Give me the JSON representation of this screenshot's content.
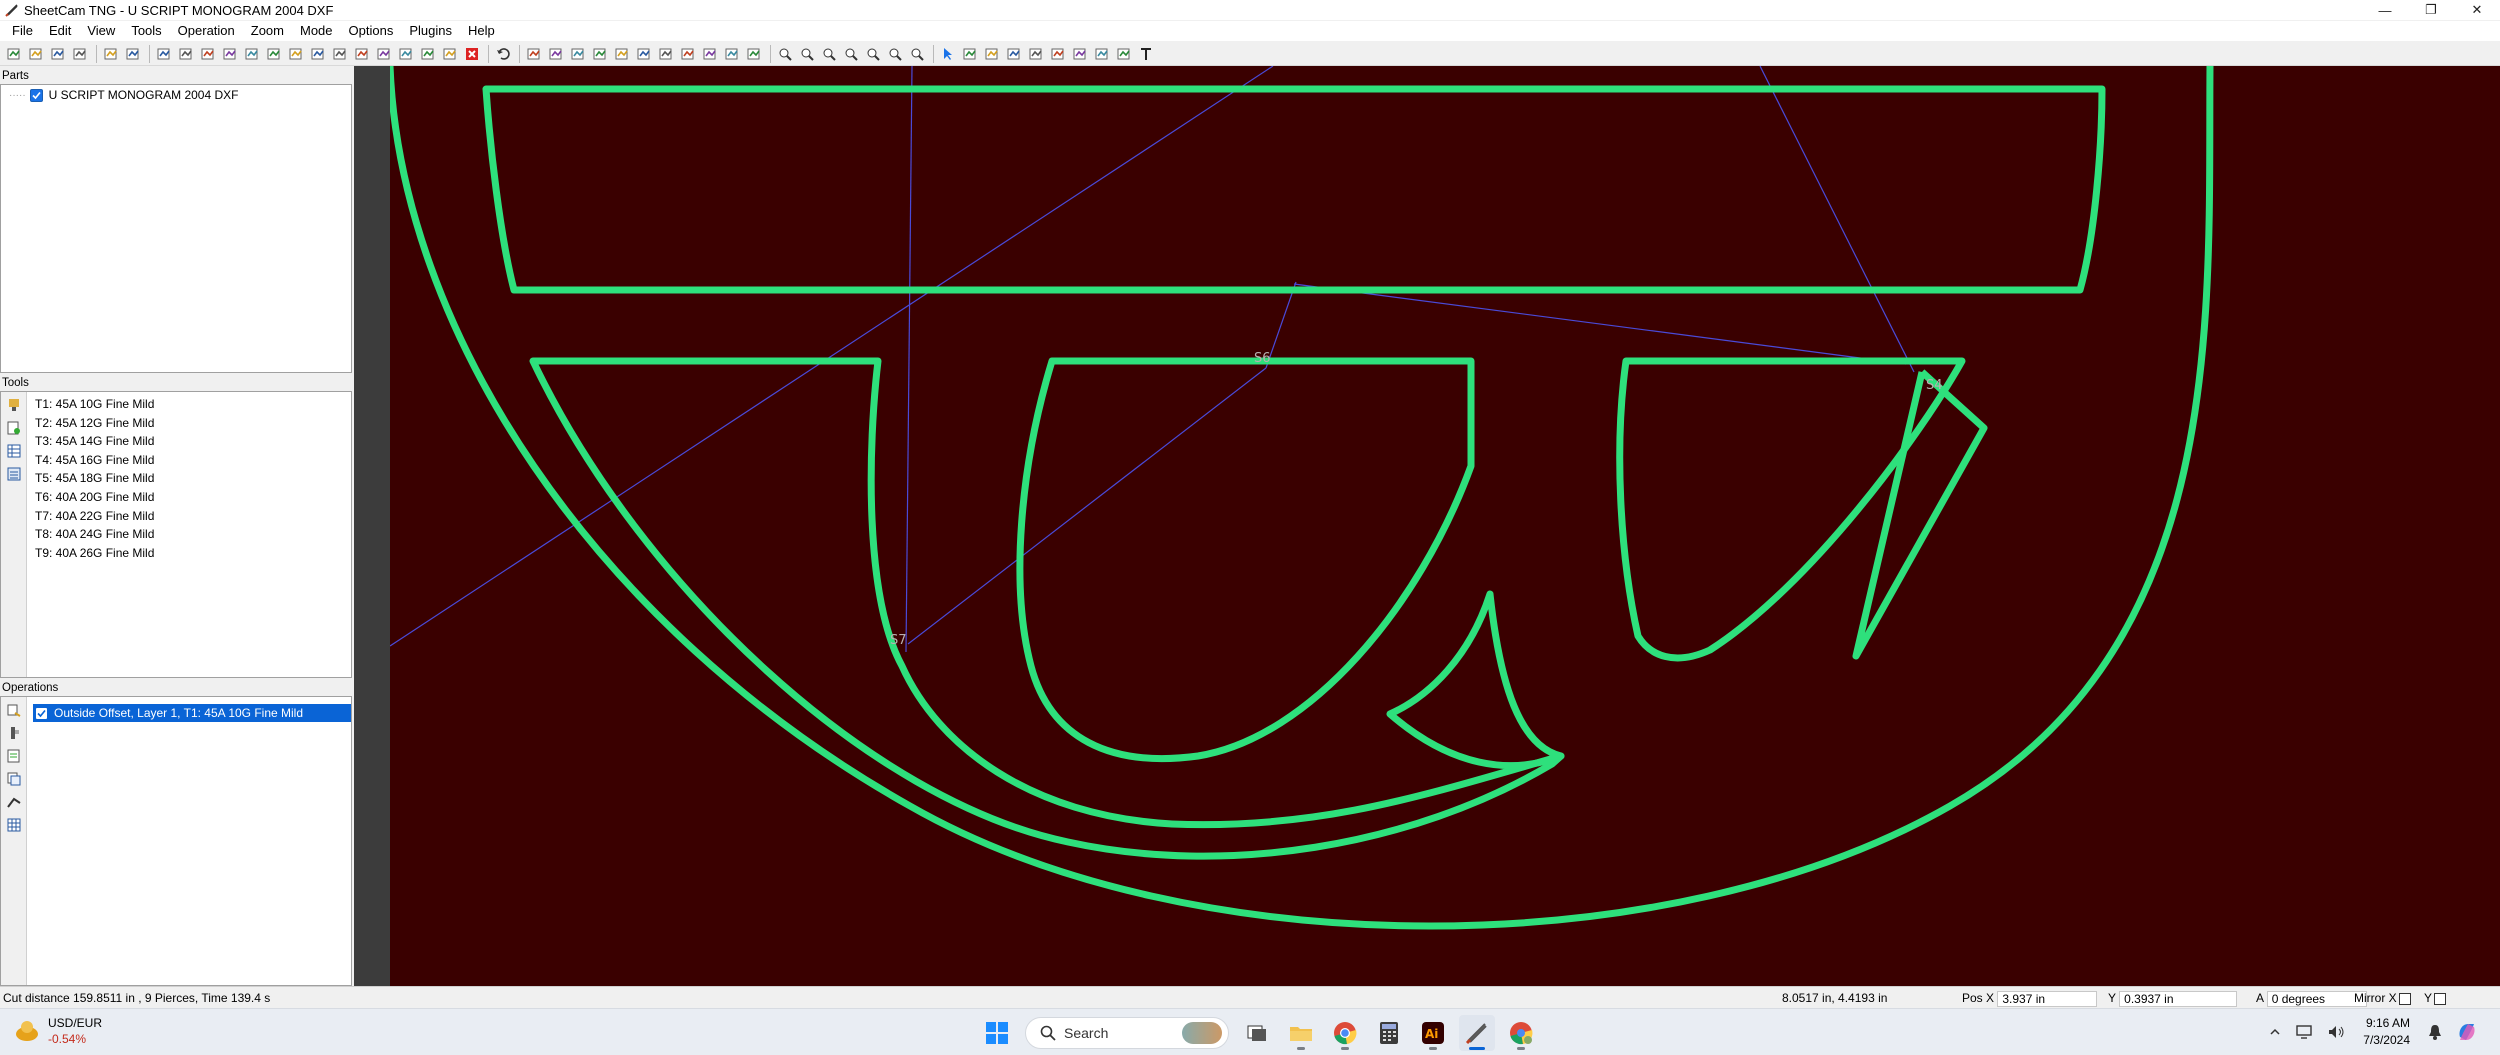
{
  "window": {
    "title": "SheetCam TNG - U SCRIPT MONOGRAM 2004 DXF",
    "controls": [
      "minimize-icon",
      "maximize-icon",
      "close-icon"
    ]
  },
  "menu": {
    "items": [
      "File",
      "Edit",
      "View",
      "Tools",
      "Operation",
      "Zoom",
      "Mode",
      "Options",
      "Plugins",
      "Help"
    ]
  },
  "toolbar": {
    "groups": [
      [
        "new-icon",
        "open-icon",
        "print-setup-icon",
        "print-icon"
      ],
      [
        "calculator-icon",
        "post-processor-icon"
      ],
      [
        "op-outline-icon",
        "op-pocket-icon",
        "op-drill-icon",
        "op-profile-icon",
        "op-jet-icon",
        "op-engrave-icon",
        "op-nest-icon",
        "op-route-icon",
        "op-tap-icon",
        "op-mark-icon",
        "op-bevel-icon",
        "op-region-icon",
        "op-toolchange-icon",
        "op-layer-icon",
        "delete-icon"
      ],
      [
        "undo-icon"
      ],
      [
        "view-3d-icon",
        "layers-icon",
        "table-icon",
        "stack-icon",
        "path-icon",
        "shape-icon",
        "snap-icon",
        "measure-icon",
        "nest-icon",
        "script-icon",
        "sheet-icon"
      ],
      [
        "zoom-in-icon",
        "zoom-out-icon",
        "zoom-fit-icon",
        "zoom-part-icon",
        "zoom-window-icon",
        "zoom-prev-icon",
        "zoom-next-icon"
      ],
      [
        "select-icon",
        "select-tool-icon",
        "node-edit-icon",
        "start-point-icon",
        "drill-point-icon",
        "move-icon",
        "rotate-icon",
        "scale-icon",
        "lead-icon",
        "text-icon"
      ]
    ]
  },
  "parts_panel": {
    "title": "Parts",
    "items": [
      {
        "label": "U SCRIPT MONOGRAM 2004 DXF",
        "checked": true
      }
    ]
  },
  "tools_panel": {
    "title": "Tools",
    "items": [
      "T1: 45A 10G Fine Mild",
      "T2: 45A 12G Fine Mild",
      "T3: 45A 14G Fine Mild",
      "T4: 45A 16G Fine Mild",
      "T5: 45A 18G Fine Mild",
      "T6: 40A 20G Fine Mild",
      "T7: 40A 22G Fine Mild",
      "T8: 40A 24G Fine Mild",
      "T9: 40A 26G Fine Mild"
    ],
    "side_icons": [
      "plasma-tool-icon",
      "new-tool-icon",
      "tool-table-icon",
      "tool-list-icon"
    ]
  },
  "operations_panel": {
    "title": "Operations",
    "items": [
      {
        "label": "Outside Offset, Layer 1, T1: 45A 10G Fine Mild",
        "checked": true,
        "selected": true
      }
    ],
    "side_icons": [
      "op-list-icon",
      "op-settings-icon",
      "op-edit-icon",
      "op-copy-icon",
      "op-path-icon",
      "op-table-icon"
    ]
  },
  "canvas": {
    "background": "#3a0000",
    "path_color": "#2ee07c",
    "rapid_color": "#4a4ad8",
    "labels": {
      "s4": "S4",
      "s6": "S6",
      "s7": "S7"
    }
  },
  "status": {
    "summary": "Cut distance 159.8511 in , 9 Pierces, Time 139.4 s",
    "cursor": "8.0517 in, 4.4193 in",
    "pos_x_label": "Pos X",
    "pos_x_value": "3.937 in",
    "y_label": "Y",
    "y_value": "0.3937 in",
    "a_label": "A",
    "a_value": "0 degrees",
    "mirror_x_label": "Mirror X",
    "mirror_y_label": "Y"
  },
  "taskbar": {
    "widget_title": "USD/EUR",
    "widget_value": "-0.54%",
    "search_label": "Search",
    "apps": [
      "windows-start-icon",
      "search-icon",
      "task-view-icon",
      "file-explorer-icon",
      "chrome-icon",
      "calculator-app-icon",
      "illustrator-icon",
      "sheetcam-icon",
      "chrome-profile-icon"
    ],
    "time": "9:16 AM",
    "date": "7/3/2024"
  }
}
